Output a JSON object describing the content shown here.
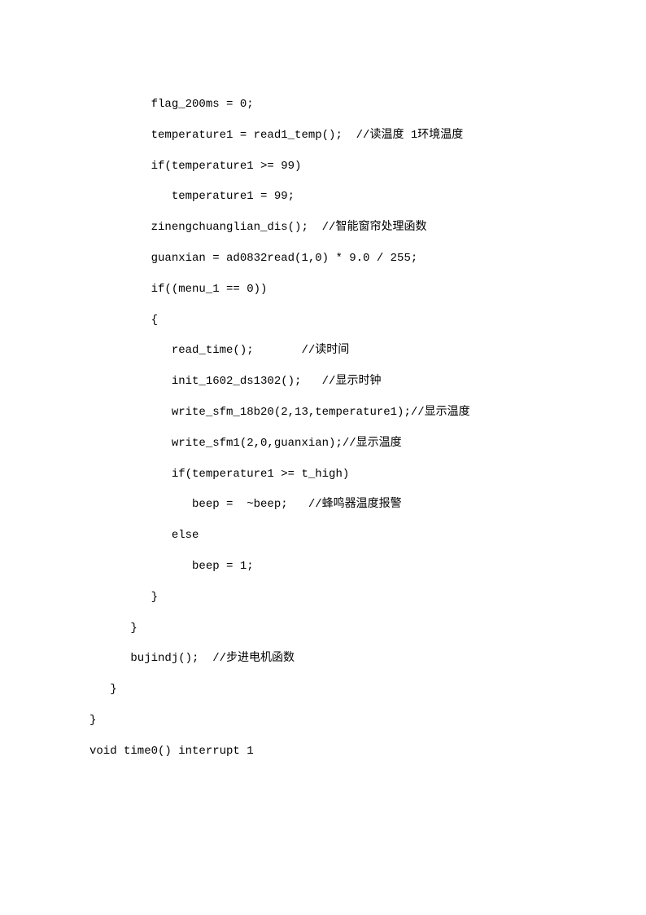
{
  "code": {
    "lines": [
      "         flag_200ms = 0;",
      "         temperature1 = read1_temp();  //读温度 1环境温度",
      "         if(temperature1 >= 99)",
      "            temperature1 = 99;",
      "         zinengchuanglian_dis();  //智能窗帘处理函数",
      "         guanxian = ad0832read(1,0) * 9.0 / 255;",
      "         if((menu_1 == 0))",
      "         {",
      "            read_time();       //读时间",
      "            init_1602_ds1302();   //显示时钟",
      "            write_sfm_18b20(2,13,temperature1);//显示温度",
      "            write_sfm1(2,0,guanxian);//显示温度",
      "            if(temperature1 >= t_high)",
      "               beep =  ~beep;   //蜂鸣器温度报警",
      "            else",
      "               beep = 1;",
      "         }",
      "      }",
      "      bujindj();  //步进电机函数",
      "   }",
      "}",
      "",
      "void time0() interrupt 1"
    ]
  }
}
